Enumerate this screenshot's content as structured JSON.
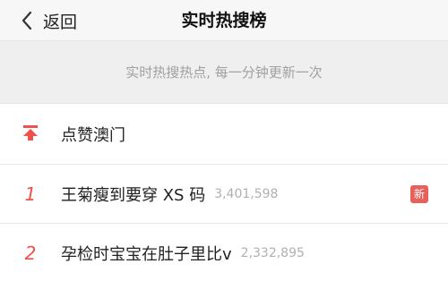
{
  "navbar": {
    "back_label": "返回",
    "title": "实时热搜榜",
    "back_icon": "chevron-left-icon"
  },
  "notice": {
    "text": "实时热搜热点, 每一分钟更新一次"
  },
  "pinned": {
    "icon": "pin-top-icon",
    "title": "点赞澳门"
  },
  "items": [
    {
      "rank": "1",
      "title": "王菊瘦到要穿 XS 码",
      "count": "3,401,598",
      "badge": "新"
    },
    {
      "rank": "2",
      "title": "孕检时宝宝在肚子里比v",
      "count": "2,332,895"
    }
  ],
  "colors": {
    "accent": "#f2504b",
    "badge": "#e8605c",
    "navbar_bg": "#f7f7f7",
    "notice_bg": "#efefef",
    "muted_text": "#a0a0a0"
  }
}
